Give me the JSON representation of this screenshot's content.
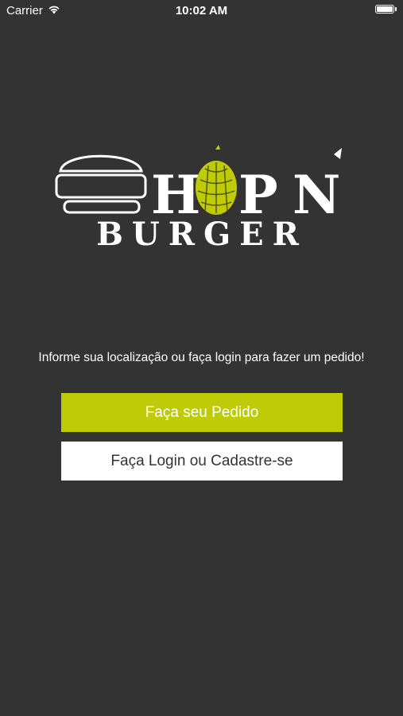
{
  "status_bar": {
    "carrier": "Carrier",
    "time": "10:02 AM",
    "battery_level": 1.0,
    "wifi_icon": "wifi-icon",
    "battery_icon": "battery-icon"
  },
  "brand": {
    "logo_text_top": "H P N´",
    "logo_text_bottom": "BURGER",
    "accent_color": "#bfcb07"
  },
  "main": {
    "message": "Informe sua localização ou faça login para fazer um pedido!",
    "order_button_label": "Faça seu Pedido",
    "login_button_label": "Faça Login ou Cadastre-se"
  },
  "colors": {
    "background": "#333333",
    "primary_button": "#bfcb07",
    "secondary_button": "#ffffff",
    "secondary_button_text": "#333333"
  }
}
